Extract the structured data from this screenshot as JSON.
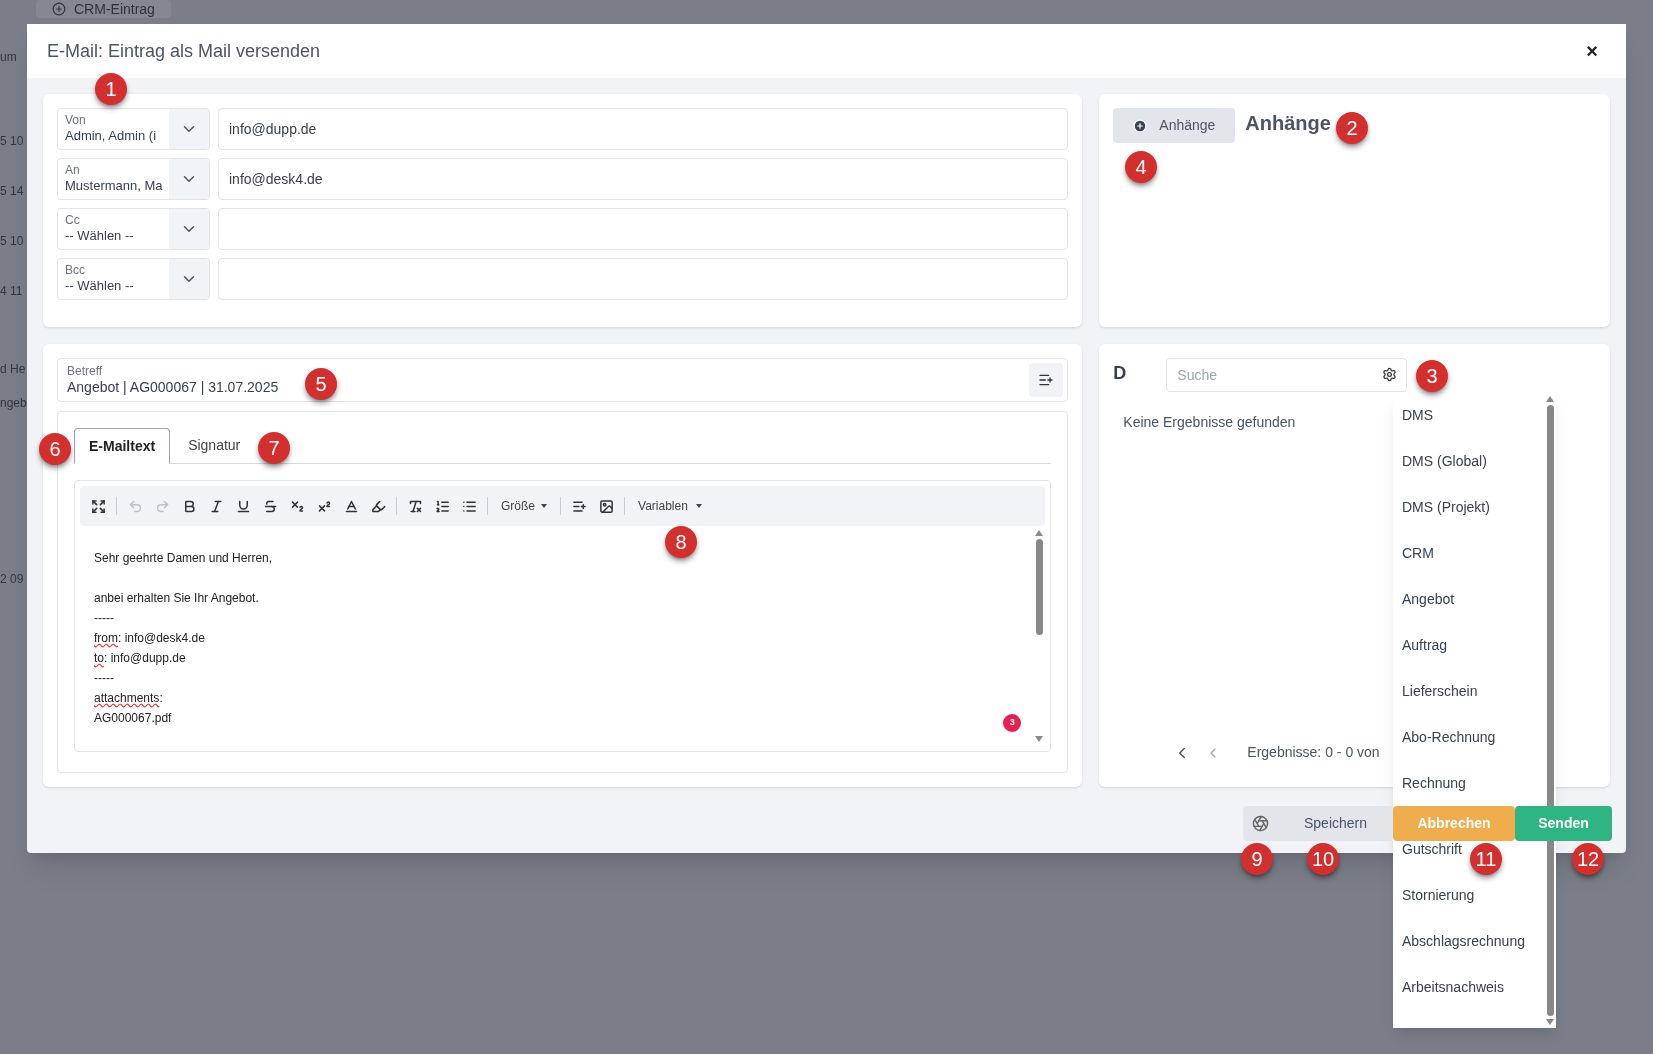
{
  "background": {
    "tab": "CRM-Eintrag",
    "cells": [
      "um",
      "5 10",
      "5 14",
      "5 10",
      "4 11",
      "d He",
      "ngeb",
      "2 09"
    ]
  },
  "dialog": {
    "title": "E-Mail: Eintrag als Mail versenden",
    "close": "×"
  },
  "recipients": [
    {
      "label": "Von",
      "value": "Admin, Admin (i",
      "address": "info@dupp.de"
    },
    {
      "label": "An",
      "value": "Mustermann, Ma",
      "address": "info@desk4.de"
    },
    {
      "label": "Cc",
      "value": "-- Wählen --"
    },
    {
      "label": "Bcc",
      "value": "-- Wählen --"
    }
  ],
  "attachments": {
    "button": "Anhänge",
    "heading": "Anhänge"
  },
  "subject": {
    "label": "Betreff",
    "value": "Angebot | AG000067 | 31.07.2025"
  },
  "tabs": [
    {
      "label": "E-Mailtext",
      "selected": true
    },
    {
      "label": "Signatur",
      "selected": false
    }
  ],
  "toolbar": {
    "undo": {
      "disabled": true
    },
    "redo": {
      "disabled": true
    },
    "size": "Größe",
    "variables": "Variablen"
  },
  "body_lines": [
    {
      "text": "Sehr geehrte Damen und Herren,"
    },
    {
      "kind": "blank"
    },
    {
      "text": "anbei erhalten Sie Ihr Angebot."
    },
    {
      "text": "-----"
    },
    {
      "flagged": "from",
      "text": ": info@desk4.de"
    },
    {
      "flagged": "to",
      "text": ": info@dupp.de"
    },
    {
      "text": "-----"
    },
    {
      "flagged": "attachments",
      "text": ":"
    },
    {
      "text": "AG000067.pdf"
    }
  ],
  "issues_badge": "3",
  "documents": {
    "heading": "D",
    "search_placeholder": "Suche",
    "empty": "Keine Ergebnisse gefunden",
    "results": "Ergebnisse: 0 - 0 von"
  },
  "menu": [
    "DMS",
    "DMS (Global)",
    "DMS (Projekt)",
    "CRM",
    "Angebot",
    "Auftrag",
    "Lieferschein",
    "Abo-Rechnung",
    "Rechnung",
    "Gutschrift",
    "Stornierung",
    "Abschlagsrechnung",
    "Arbeitsnachweis"
  ],
  "footer": {
    "save": "Speichern",
    "cancel": "Abbrechen",
    "send": "Senden"
  },
  "markers": [
    "1",
    "2",
    "3",
    "4",
    "5",
    "6",
    "7",
    "8",
    "9",
    "10",
    "11",
    "12"
  ]
}
